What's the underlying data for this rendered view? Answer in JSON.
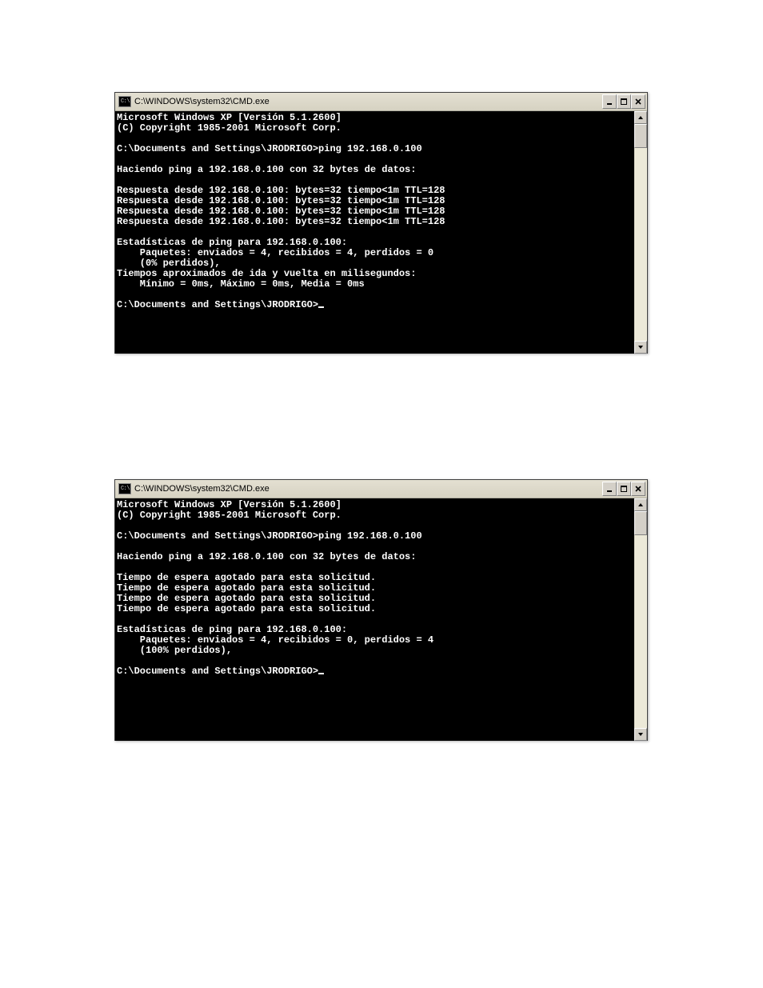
{
  "window1": {
    "title": "C:\\WINDOWS\\system32\\CMD.exe",
    "icon_text": "C:\\",
    "lines": [
      "Microsoft Windows XP [Versión 5.1.2600]",
      "(C) Copyright 1985-2001 Microsoft Corp.",
      "",
      "C:\\Documents and Settings\\JRODRIGO>ping 192.168.0.100",
      "",
      "Haciendo ping a 192.168.0.100 con 32 bytes de datos:",
      "",
      "Respuesta desde 192.168.0.100: bytes=32 tiempo<1m TTL=128",
      "Respuesta desde 192.168.0.100: bytes=32 tiempo<1m TTL=128",
      "Respuesta desde 192.168.0.100: bytes=32 tiempo<1m TTL=128",
      "Respuesta desde 192.168.0.100: bytes=32 tiempo<1m TTL=128",
      "",
      "Estadísticas de ping para 192.168.0.100:",
      "    Paquetes: enviados = 4, recibidos = 4, perdidos = 0",
      "    (0% perdidos),",
      "Tiempos aproximados de ida y vuelta en milisegundos:",
      "    Mínimo = 0ms, Máximo = 0ms, Media = 0ms",
      "",
      "C:\\Documents and Settings\\JRODRIGO>"
    ]
  },
  "window2": {
    "title": "C:\\WINDOWS\\system32\\CMD.exe",
    "icon_text": "C:\\",
    "lines": [
      "Microsoft Windows XP [Versión 5.1.2600]",
      "(C) Copyright 1985-2001 Microsoft Corp.",
      "",
      "C:\\Documents and Settings\\JRODRIGO>ping 192.168.0.100",
      "",
      "Haciendo ping a 192.168.0.100 con 32 bytes de datos:",
      "",
      "Tiempo de espera agotado para esta solicitud.",
      "Tiempo de espera agotado para esta solicitud.",
      "Tiempo de espera agotado para esta solicitud.",
      "Tiempo de espera agotado para esta solicitud.",
      "",
      "Estadísticas de ping para 192.168.0.100:",
      "    Paquetes: enviados = 4, recibidos = 0, perdidos = 4",
      "    (100% perdidos),",
      "",
      "C:\\Documents and Settings\\JRODRIGO>"
    ]
  }
}
